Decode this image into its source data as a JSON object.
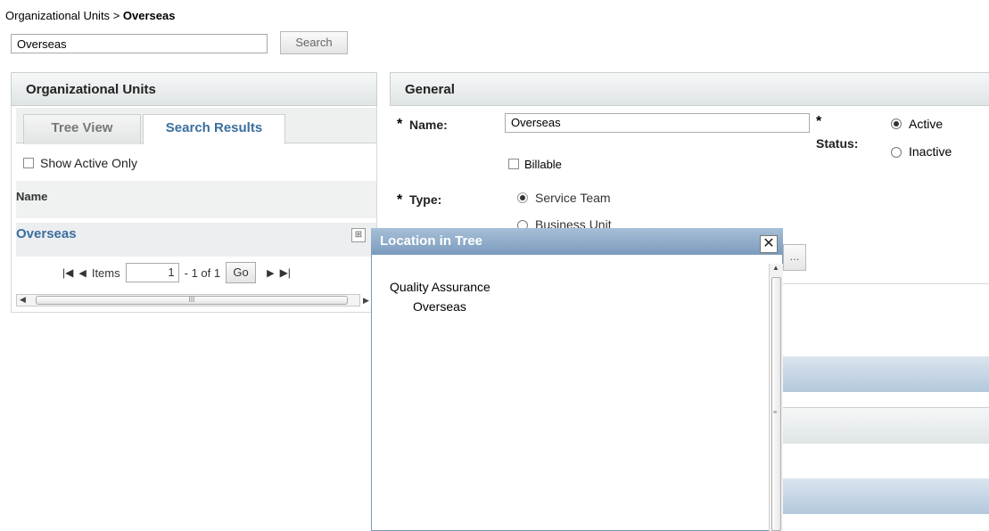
{
  "breadcrumb": {
    "root": "Organizational Units",
    "separator": ">",
    "current": "Overseas"
  },
  "search": {
    "value": "Overseas",
    "button": "Search"
  },
  "left_panel": {
    "title": "Organizational Units",
    "tabs": [
      {
        "label": "Tree View"
      },
      {
        "label": "Search Results"
      }
    ],
    "show_active_only": "Show Active Only",
    "column_name": "Name",
    "rows": [
      {
        "name": "Overseas"
      }
    ],
    "pager": {
      "items_label": "Items",
      "page_value": "1",
      "range": "- 1  of 1",
      "go": "Go"
    }
  },
  "general": {
    "title": "General",
    "name_label": "Name:",
    "name_value": "Overseas",
    "status_label": "Status:",
    "status_options": [
      {
        "label": "Active",
        "selected": true
      },
      {
        "label": "Inactive",
        "selected": false
      }
    ],
    "billable_label": "Billable",
    "type_label": "Type:",
    "type_options": [
      {
        "label": "Service Team",
        "selected": true
      },
      {
        "label": "Business Unit",
        "selected": false
      }
    ],
    "required_mark": "*",
    "more_btn": "..."
  },
  "dialog": {
    "title": "Location in Tree",
    "close": "✕",
    "tree": [
      "Quality Assurance",
      "Overseas"
    ]
  },
  "colors": {
    "link": "#3c6e9e",
    "dialog_title": "#7b9bbd",
    "band": "#b3c8dc"
  }
}
